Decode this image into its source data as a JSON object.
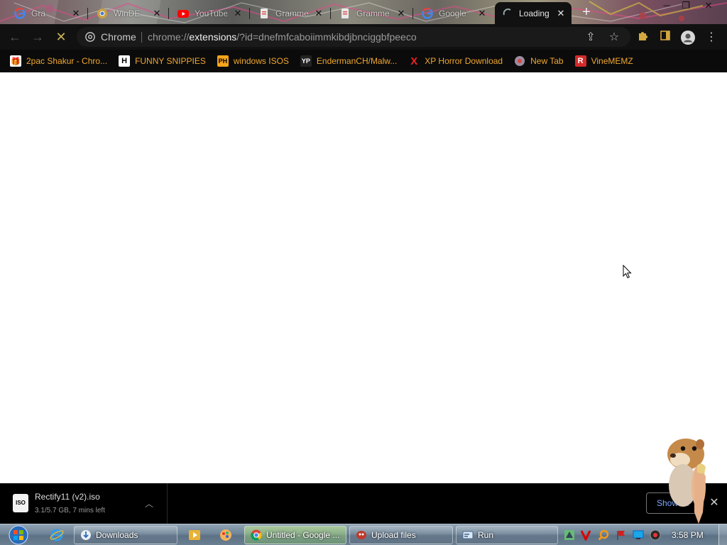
{
  "tabs": [
    {
      "title": "Gra",
      "favicon": "google-icon"
    },
    {
      "title": "WinDE",
      "favicon": "chrome-icon"
    },
    {
      "title": "YouTube",
      "favicon": "youtube-icon"
    },
    {
      "title": "Gramme",
      "favicon": "docs-icon"
    },
    {
      "title": "Gramme",
      "favicon": "docs-icon"
    },
    {
      "title": "Google",
      "favicon": "google-icon"
    },
    {
      "title": "Loading",
      "favicon": "spinner-icon",
      "active": true
    }
  ],
  "toolbar": {
    "chip_label": "Chrome",
    "url_prefix": "chrome://",
    "url_host": "extensions",
    "url_rest": "/?id=dnefmfcaboiimmkibdjbnciggbfpeeco"
  },
  "bookmarks": [
    {
      "label": "2pac Shakur - Chro...",
      "icon": "gift-icon"
    },
    {
      "label": "FUNNY SNIPPIES",
      "icon": "h-icon",
      "glyph": "H"
    },
    {
      "label": "windows ISOS",
      "icon": "ph-icon",
      "glyph": "PH"
    },
    {
      "label": "EndermanCH/Malw...",
      "icon": "yp-icon",
      "glyph": "YP"
    },
    {
      "label": "XP Horror Download",
      "icon": "x-icon",
      "glyph": "X"
    },
    {
      "label": "New Tab",
      "icon": "globe-icon"
    },
    {
      "label": "VineMEMZ",
      "icon": "r-icon",
      "glyph": "R"
    }
  ],
  "download": {
    "filename": "Rectify11 (v2).iso",
    "status": "3.1/5.7 GB, 7 mins left",
    "icon_label": "ISO",
    "show_all_label": "Show all"
  },
  "taskbar": {
    "buttons": [
      {
        "label": "Downloads"
      },
      {
        "label": "Untitled - Google ...",
        "active": true
      },
      {
        "label": "Upload files"
      },
      {
        "label": "Run"
      }
    ],
    "clock": "3:58 PM"
  }
}
